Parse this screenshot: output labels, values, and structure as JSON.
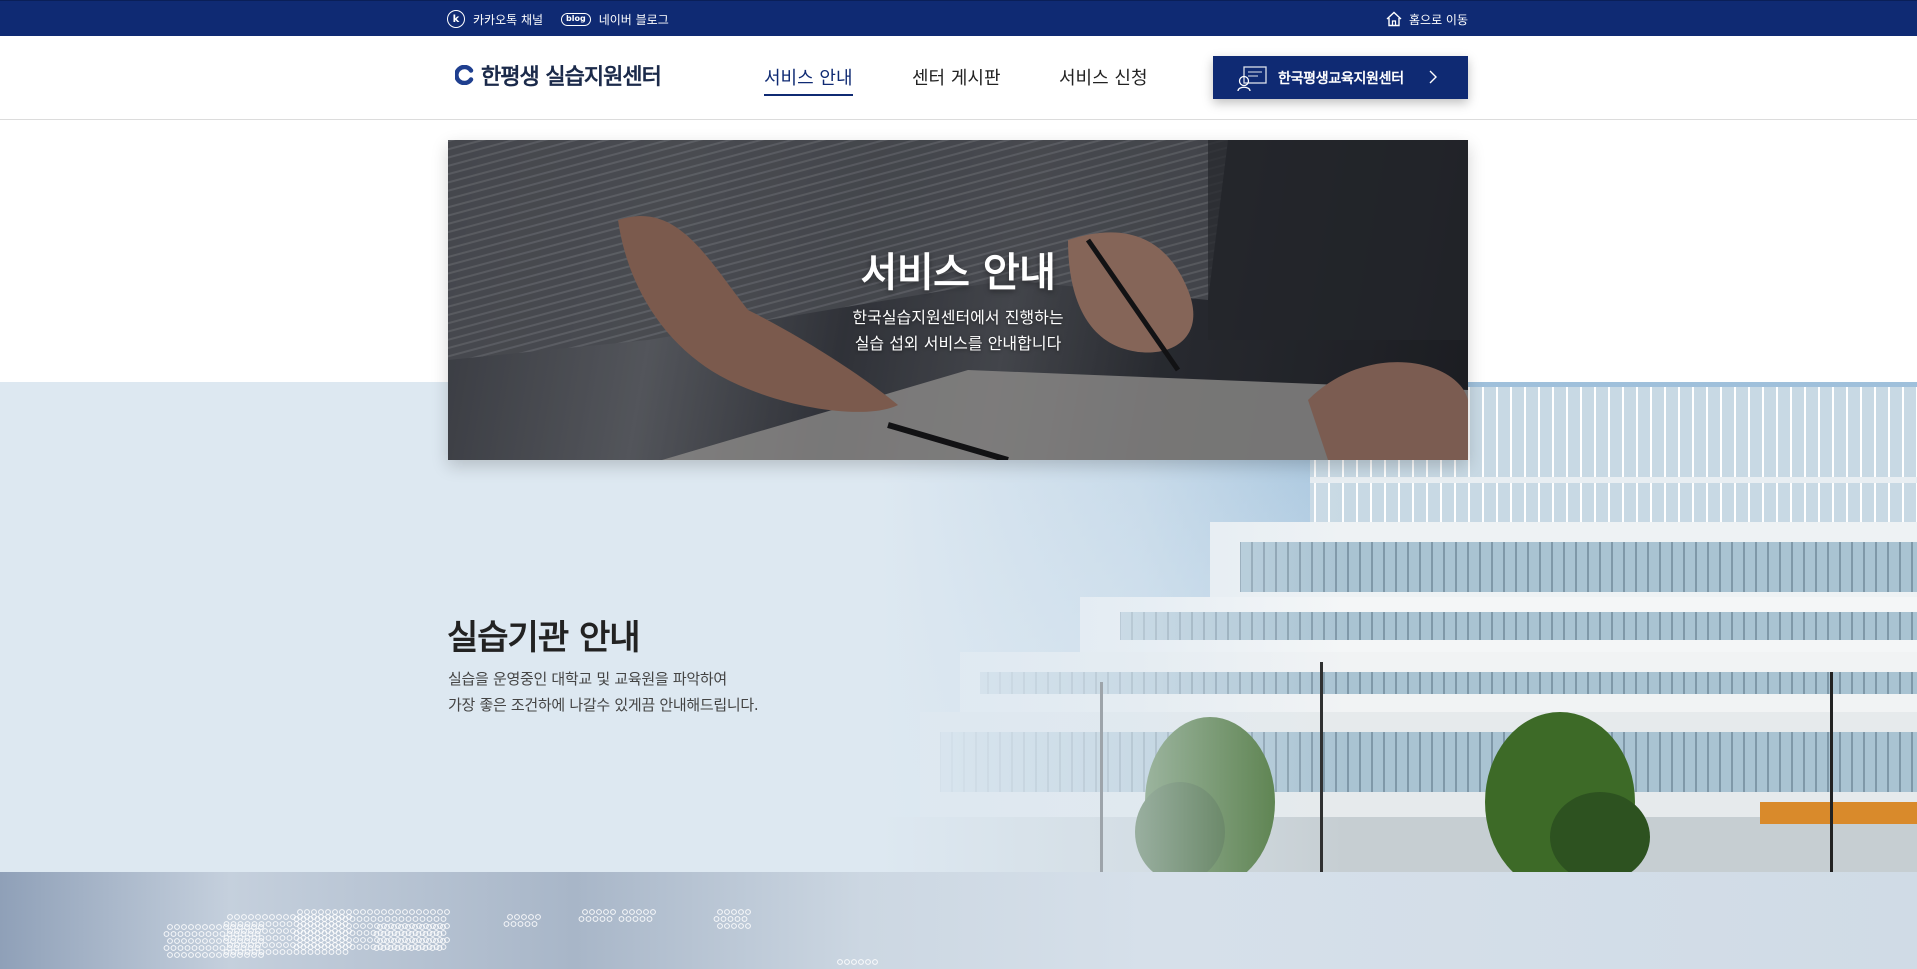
{
  "topbar": {
    "kakao_icon_glyph": "k",
    "kakao_label": "카카오톡 채널",
    "blog_icon_text": "blog",
    "blog_label": "네이버 블로그",
    "home_label": "홈으로 이동"
  },
  "header": {
    "logo_text": "한평생 실습지원센터",
    "nav": [
      {
        "label": "서비스 안내",
        "active": true
      },
      {
        "label": "센터 게시판",
        "active": false
      },
      {
        "label": "서비스 신청",
        "active": false
      }
    ],
    "cta_label": "한국평생교육지원센터"
  },
  "hero": {
    "title": "서비스 안내",
    "subtitle_line1": "한국실습지원센터에서 진행하는",
    "subtitle_line2": "실습 섭외 서비스를 안내합니다"
  },
  "section": {
    "title": "실습기관 안내",
    "line1": "실습을 운영중인 대학교 및 교육원을 파악하여",
    "line2": "가장 좋은 조건하에 나갈수 있게끔 안내해드립니다."
  },
  "colors": {
    "primary": "#0f2a73",
    "band": "#dde8f1"
  }
}
